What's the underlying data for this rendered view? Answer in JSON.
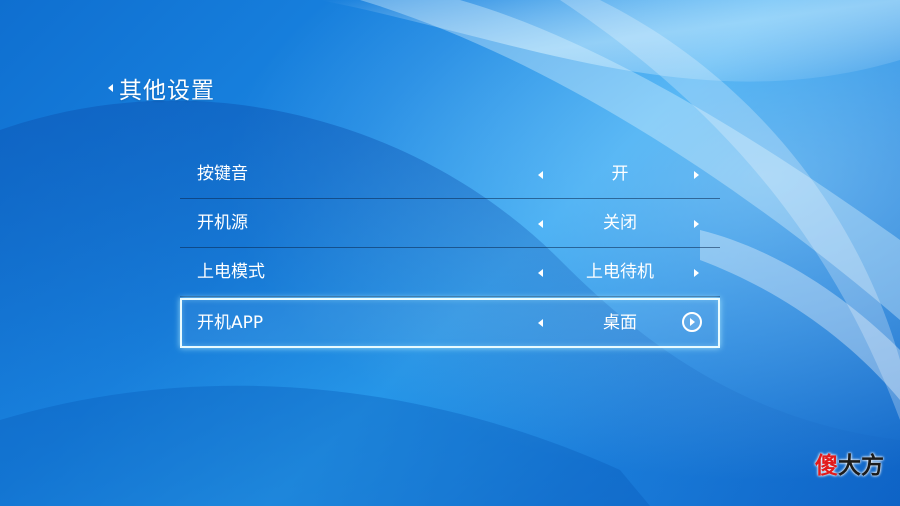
{
  "header": {
    "title": "其他设置",
    "back_icon": "chevron-left-icon"
  },
  "settings": [
    {
      "label": "按键音",
      "value": "开"
    },
    {
      "label": "开机源",
      "value": "关闭"
    },
    {
      "label": "上电模式",
      "value": "上电待机"
    },
    {
      "label": "开机APP",
      "value": "桌面",
      "selected": true
    }
  ],
  "watermark": {
    "part1": "傻",
    "part2": "大方"
  },
  "colors": {
    "background": "#1a86e2",
    "selection_border": "#e8fbff",
    "text": "#ffffff"
  }
}
